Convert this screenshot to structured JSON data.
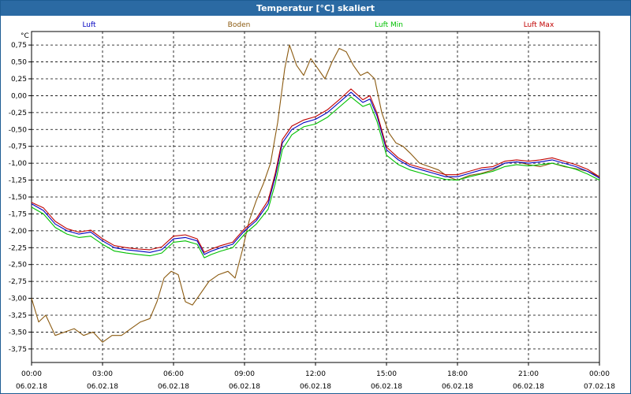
{
  "window": {
    "title": "Temperatur [°C] skaliert"
  },
  "chart_data": {
    "type": "line",
    "title": "Temperatur [°C] skaliert",
    "ylabel": "°C",
    "xlabel": "",
    "ylim": [
      -3.95,
      0.95
    ],
    "xlim": [
      0,
      24
    ],
    "grid": true,
    "legend_position": "top",
    "y_ticks": [
      "0,75",
      "0,50",
      "0,25",
      "0,00",
      "-0,25",
      "-0,50",
      "-0,75",
      "-1,00",
      "-1,25",
      "-1,50",
      "-1,75",
      "-2,00",
      "-2,25",
      "-2,50",
      "-2,75",
      "-3,00",
      "-3,25",
      "-3,50",
      "-3,75"
    ],
    "x_ticks": [
      {
        "time": "00:00",
        "date": "06.02.18"
      },
      {
        "time": "03:00",
        "date": "06.02.18"
      },
      {
        "time": "06:00",
        "date": "06.02.18"
      },
      {
        "time": "09:00",
        "date": "06.02.18"
      },
      {
        "time": "12:00",
        "date": "06.02.18"
      },
      {
        "time": "15:00",
        "date": "06.02.18"
      },
      {
        "time": "18:00",
        "date": "06.02.18"
      },
      {
        "time": "21:00",
        "date": "06.02.18"
      },
      {
        "time": "00:00",
        "date": "07.02.18"
      }
    ],
    "series": [
      {
        "name": "Luft",
        "color": "#0000c0",
        "points": [
          [
            0,
            -1.6
          ],
          [
            0.5,
            -1.7
          ],
          [
            1,
            -1.9
          ],
          [
            1.5,
            -2.0
          ],
          [
            2,
            -2.05
          ],
          [
            2.5,
            -2.02
          ],
          [
            3,
            -2.15
          ],
          [
            3.5,
            -2.25
          ],
          [
            4,
            -2.28
          ],
          [
            4.5,
            -2.3
          ],
          [
            5,
            -2.32
          ],
          [
            5.5,
            -2.28
          ],
          [
            6,
            -2.12
          ],
          [
            6.5,
            -2.1
          ],
          [
            7,
            -2.15
          ],
          [
            7.3,
            -2.35
          ],
          [
            7.6,
            -2.3
          ],
          [
            8,
            -2.25
          ],
          [
            8.5,
            -2.2
          ],
          [
            9,
            -2.0
          ],
          [
            9.5,
            -1.85
          ],
          [
            10,
            -1.6
          ],
          [
            10.3,
            -1.2
          ],
          [
            10.6,
            -0.7
          ],
          [
            11,
            -0.5
          ],
          [
            11.5,
            -0.4
          ],
          [
            12,
            -0.35
          ],
          [
            12.5,
            -0.25
          ],
          [
            13,
            -0.1
          ],
          [
            13.5,
            0.05
          ],
          [
            14,
            -0.1
          ],
          [
            14.3,
            -0.05
          ],
          [
            14.6,
            -0.3
          ],
          [
            15,
            -0.8
          ],
          [
            15.5,
            -0.95
          ],
          [
            16,
            -1.05
          ],
          [
            16.5,
            -1.1
          ],
          [
            17,
            -1.15
          ],
          [
            17.5,
            -1.2
          ],
          [
            18,
            -1.2
          ],
          [
            18.5,
            -1.15
          ],
          [
            19,
            -1.1
          ],
          [
            19.5,
            -1.08
          ],
          [
            20,
            -1.0
          ],
          [
            20.5,
            -0.98
          ],
          [
            21,
            -1.0
          ],
          [
            21.5,
            -0.98
          ],
          [
            22,
            -0.95
          ],
          [
            22.5,
            -1.0
          ],
          [
            23,
            -1.05
          ],
          [
            23.5,
            -1.12
          ],
          [
            24,
            -1.22
          ]
        ]
      },
      {
        "name": "Boden",
        "color": "#8b5a10",
        "points": [
          [
            0,
            -3.0
          ],
          [
            0.3,
            -3.35
          ],
          [
            0.6,
            -3.25
          ],
          [
            1,
            -3.55
          ],
          [
            1.4,
            -3.5
          ],
          [
            1.8,
            -3.45
          ],
          [
            2.2,
            -3.55
          ],
          [
            2.6,
            -3.5
          ],
          [
            3,
            -3.65
          ],
          [
            3.4,
            -3.55
          ],
          [
            3.8,
            -3.55
          ],
          [
            4.2,
            -3.45
          ],
          [
            4.6,
            -3.35
          ],
          [
            5,
            -3.3
          ],
          [
            5.3,
            -3.05
          ],
          [
            5.6,
            -2.7
          ],
          [
            5.9,
            -2.6
          ],
          [
            6.2,
            -2.65
          ],
          [
            6.5,
            -3.05
          ],
          [
            6.8,
            -3.1
          ],
          [
            7.1,
            -2.95
          ],
          [
            7.5,
            -2.75
          ],
          [
            7.9,
            -2.65
          ],
          [
            8.3,
            -2.6
          ],
          [
            8.6,
            -2.7
          ],
          [
            8.9,
            -2.3
          ],
          [
            9.2,
            -1.85
          ],
          [
            9.5,
            -1.55
          ],
          [
            9.8,
            -1.3
          ],
          [
            10.1,
            -1.0
          ],
          [
            10.4,
            -0.4
          ],
          [
            10.7,
            0.4
          ],
          [
            10.9,
            0.75
          ],
          [
            11.2,
            0.45
          ],
          [
            11.5,
            0.3
          ],
          [
            11.8,
            0.55
          ],
          [
            12.1,
            0.4
          ],
          [
            12.4,
            0.25
          ],
          [
            12.7,
            0.5
          ],
          [
            13,
            0.7
          ],
          [
            13.3,
            0.65
          ],
          [
            13.6,
            0.45
          ],
          [
            13.9,
            0.3
          ],
          [
            14.2,
            0.35
          ],
          [
            14.5,
            0.25
          ],
          [
            14.8,
            -0.25
          ],
          [
            15.1,
            -0.55
          ],
          [
            15.4,
            -0.7
          ],
          [
            15.7,
            -0.75
          ],
          [
            16,
            -0.85
          ],
          [
            16.4,
            -1.0
          ],
          [
            16.8,
            -1.05
          ],
          [
            17.2,
            -1.1
          ],
          [
            17.6,
            -1.2
          ],
          [
            18,
            -1.25
          ],
          [
            18.5,
            -1.18
          ],
          [
            19,
            -1.15
          ],
          [
            19.5,
            -1.1
          ],
          [
            20,
            -1.0
          ],
          [
            20.5,
            -0.98
          ],
          [
            21,
            -1.02
          ],
          [
            21.5,
            -1.05
          ],
          [
            22,
            -1.0
          ],
          [
            22.5,
            -1.05
          ],
          [
            23,
            -1.08
          ],
          [
            23.5,
            -1.12
          ],
          [
            24,
            -1.2
          ]
        ]
      },
      {
        "name": "Luft Min",
        "color": "#00c000",
        "points": [
          [
            0,
            -1.65
          ],
          [
            0.5,
            -1.75
          ],
          [
            1,
            -1.95
          ],
          [
            1.5,
            -2.05
          ],
          [
            2,
            -2.1
          ],
          [
            2.5,
            -2.08
          ],
          [
            3,
            -2.2
          ],
          [
            3.5,
            -2.3
          ],
          [
            4,
            -2.33
          ],
          [
            4.5,
            -2.35
          ],
          [
            5,
            -2.37
          ],
          [
            5.5,
            -2.33
          ],
          [
            6,
            -2.17
          ],
          [
            6.5,
            -2.15
          ],
          [
            7,
            -2.2
          ],
          [
            7.3,
            -2.4
          ],
          [
            7.6,
            -2.35
          ],
          [
            8,
            -2.3
          ],
          [
            8.5,
            -2.25
          ],
          [
            9,
            -2.05
          ],
          [
            9.5,
            -1.9
          ],
          [
            10,
            -1.68
          ],
          [
            10.3,
            -1.3
          ],
          [
            10.6,
            -0.8
          ],
          [
            11,
            -0.58
          ],
          [
            11.5,
            -0.46
          ],
          [
            12,
            -0.42
          ],
          [
            12.5,
            -0.32
          ],
          [
            13,
            -0.17
          ],
          [
            13.5,
            -0.02
          ],
          [
            14,
            -0.16
          ],
          [
            14.3,
            -0.12
          ],
          [
            14.6,
            -0.38
          ],
          [
            15,
            -0.88
          ],
          [
            15.5,
            -1.02
          ],
          [
            16,
            -1.1
          ],
          [
            16.5,
            -1.15
          ],
          [
            17,
            -1.2
          ],
          [
            17.5,
            -1.24
          ],
          [
            18,
            -1.25
          ],
          [
            18.5,
            -1.2
          ],
          [
            19,
            -1.16
          ],
          [
            19.5,
            -1.12
          ],
          [
            20,
            -1.05
          ],
          [
            20.5,
            -1.02
          ],
          [
            21,
            -1.04
          ],
          [
            21.5,
            -1.02
          ],
          [
            22,
            -1.0
          ],
          [
            22.5,
            -1.04
          ],
          [
            23,
            -1.09
          ],
          [
            23.5,
            -1.16
          ],
          [
            24,
            -1.25
          ]
        ]
      },
      {
        "name": "Luft Max",
        "color": "#c00000",
        "points": [
          [
            0,
            -1.58
          ],
          [
            0.5,
            -1.66
          ],
          [
            1,
            -1.86
          ],
          [
            1.5,
            -1.97
          ],
          [
            2,
            -2.02
          ],
          [
            2.5,
            -1.99
          ],
          [
            3,
            -2.12
          ],
          [
            3.5,
            -2.22
          ],
          [
            4,
            -2.25
          ],
          [
            4.5,
            -2.27
          ],
          [
            5,
            -2.28
          ],
          [
            5.5,
            -2.24
          ],
          [
            6,
            -2.08
          ],
          [
            6.5,
            -2.06
          ],
          [
            7,
            -2.12
          ],
          [
            7.3,
            -2.32
          ],
          [
            7.6,
            -2.27
          ],
          [
            8,
            -2.22
          ],
          [
            8.5,
            -2.17
          ],
          [
            9,
            -1.97
          ],
          [
            9.5,
            -1.82
          ],
          [
            10,
            -1.55
          ],
          [
            10.3,
            -1.15
          ],
          [
            10.6,
            -0.65
          ],
          [
            11,
            -0.45
          ],
          [
            11.5,
            -0.36
          ],
          [
            12,
            -0.31
          ],
          [
            12.5,
            -0.21
          ],
          [
            13,
            -0.06
          ],
          [
            13.5,
            0.1
          ],
          [
            14,
            -0.06
          ],
          [
            14.3,
            0.0
          ],
          [
            14.6,
            -0.26
          ],
          [
            15,
            -0.76
          ],
          [
            15.5,
            -0.92
          ],
          [
            16,
            -1.02
          ],
          [
            16.5,
            -1.07
          ],
          [
            17,
            -1.12
          ],
          [
            17.5,
            -1.17
          ],
          [
            18,
            -1.17
          ],
          [
            18.5,
            -1.12
          ],
          [
            19,
            -1.07
          ],
          [
            19.5,
            -1.05
          ],
          [
            20,
            -0.97
          ],
          [
            20.5,
            -0.95
          ],
          [
            21,
            -0.97
          ],
          [
            21.5,
            -0.95
          ],
          [
            22,
            -0.92
          ],
          [
            22.5,
            -0.97
          ],
          [
            23,
            -1.02
          ],
          [
            23.5,
            -1.09
          ],
          [
            24,
            -1.2
          ]
        ]
      }
    ]
  }
}
